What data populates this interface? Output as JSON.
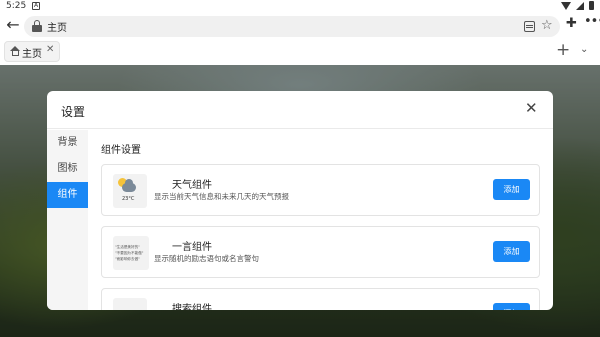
{
  "status_bar": {
    "time": "5:25",
    "notif_glyph": "A"
  },
  "browser": {
    "url_text": "主页",
    "icons": [
      "back-arrow-icon",
      "lock-icon",
      "reader-mode-icon",
      "star-icon",
      "extension-icon",
      "more-menu-icon"
    ]
  },
  "tabs": [
    {
      "label": "主页",
      "icon": "home-icon",
      "close": "✕"
    }
  ],
  "tab_actions": {
    "new_tab": "+",
    "tab_list": "⌄"
  },
  "modal": {
    "title": "设置",
    "close": "✕",
    "nav": [
      {
        "label": "背景",
        "active": false
      },
      {
        "label": "图标",
        "active": false
      },
      {
        "label": "组件",
        "active": true
      }
    ],
    "section_title": "组件设置",
    "widgets": [
      {
        "name": "天气组件",
        "description": "显示当前天气信息和未来几天的天气预报",
        "button": "添加",
        "thumb": {
          "temp": "23°C"
        }
      },
      {
        "name": "一言组件",
        "description": "显示随机的励志语句或名言警句",
        "button": "添加",
        "thumb": {
          "lines": [
            "\"生活是美好的\"",
            "\"不要因为不能做\"",
            "\"而影响你去做\""
          ]
        }
      },
      {
        "name": "搜索组件",
        "description": "",
        "button": "添加"
      }
    ]
  },
  "colors": {
    "accent": "#1a88f5",
    "overlay": "rgba(0,0,0,0.38)"
  }
}
